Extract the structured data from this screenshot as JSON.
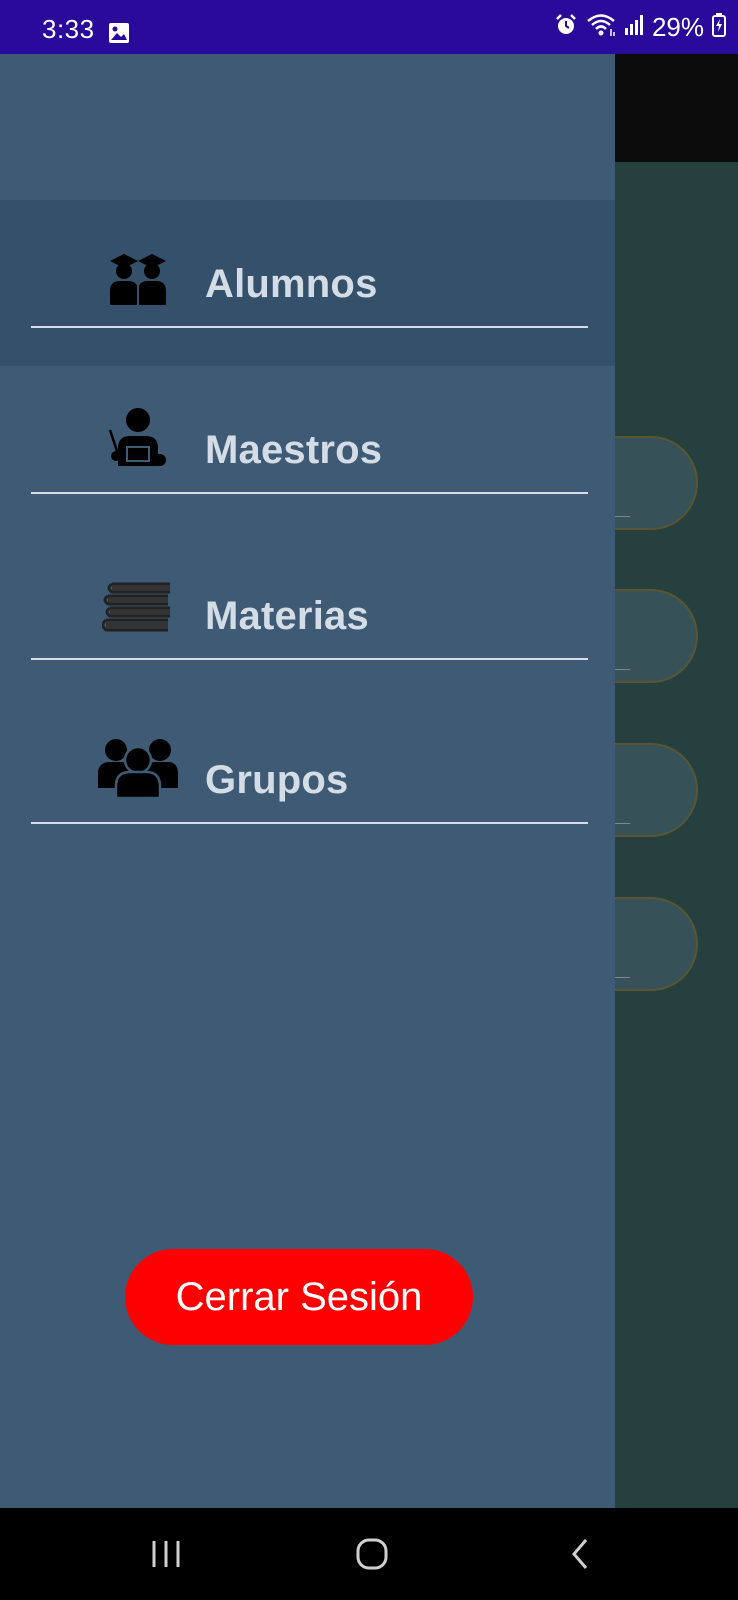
{
  "status_bar": {
    "time": "3:33",
    "battery": "29%",
    "icons": [
      "gallery-icon",
      "alarm-icon",
      "wifi-icon",
      "signal-icon",
      "battery-charging-icon"
    ]
  },
  "drawer": {
    "items": [
      {
        "label": "Alumnos",
        "icon": "students-graduation-icon",
        "selected": true
      },
      {
        "label": "Maestros",
        "icon": "teacher-icon",
        "selected": false
      },
      {
        "label": "Materias",
        "icon": "books-icon",
        "selected": false
      },
      {
        "label": "Grupos",
        "icon": "group-icon",
        "selected": false
      }
    ],
    "logout_label": "Cerrar Sesión"
  },
  "nav_bar": {
    "icons": [
      "recents-icon",
      "home-icon",
      "back-icon"
    ]
  },
  "colors": {
    "status_bar": "#2a0a9a",
    "drawer": "#3e5a74",
    "drawer_selected": "#34506b",
    "logout": "#ff0000",
    "background_app": "#25403f"
  }
}
